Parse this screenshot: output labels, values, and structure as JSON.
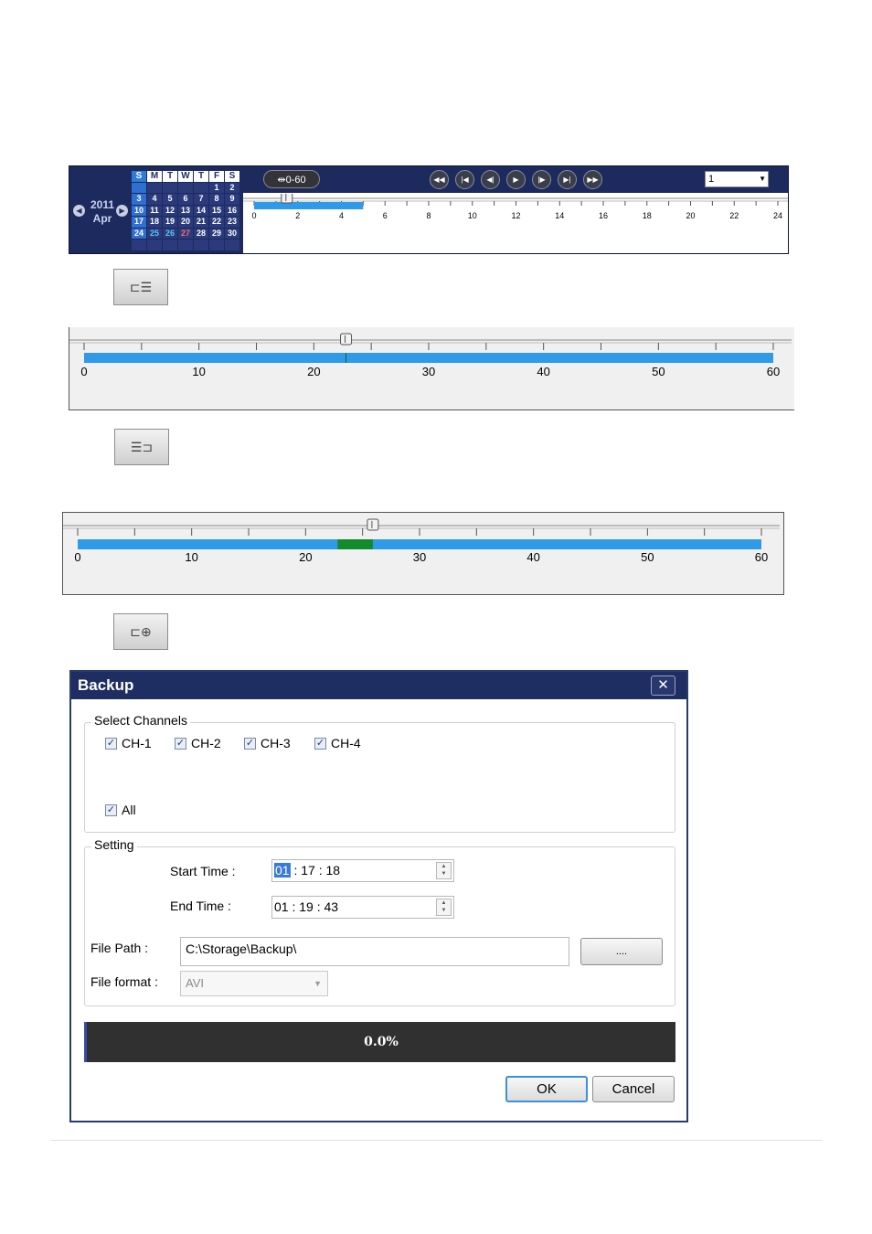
{
  "calendar": {
    "year": "2011",
    "month": "Apr",
    "weekday_headers": [
      "S",
      "M",
      "T",
      "W",
      "T",
      "F",
      "S"
    ],
    "weeks": [
      [
        "",
        "",
        "",
        "",
        "",
        "1",
        "2"
      ],
      [
        "3",
        "4",
        "5",
        "6",
        "7",
        "8",
        "9"
      ],
      [
        "10",
        "11",
        "12",
        "13",
        "14",
        "15",
        "16"
      ],
      [
        "17",
        "18",
        "19",
        "20",
        "21",
        "22",
        "23"
      ],
      [
        "24",
        "25",
        "26",
        "27",
        "28",
        "29",
        "30"
      ],
      [
        "",
        "",
        "",
        "",
        "",
        "",
        ""
      ]
    ]
  },
  "toolbar": {
    "range_label": "⇹0-60",
    "channel_value": "1",
    "playback_buttons": [
      {
        "name": "fast-rewind-button",
        "glyph": "◀◀"
      },
      {
        "name": "previous-frame-button",
        "glyph": "|◀"
      },
      {
        "name": "step-back-button",
        "glyph": "◀|"
      },
      {
        "name": "play-button",
        "glyph": "▶"
      },
      {
        "name": "step-forward-button",
        "glyph": "|▶"
      },
      {
        "name": "next-frame-button",
        "glyph": "▶|"
      },
      {
        "name": "fast-forward-button",
        "glyph": "▶▶"
      }
    ]
  },
  "day_timeline": {
    "ticks": [
      "0",
      "2",
      "4",
      "6",
      "8",
      "10",
      "12",
      "14",
      "16",
      "18",
      "20",
      "22",
      "24"
    ],
    "max": 24,
    "recorded": [
      0,
      5
    ],
    "cursor": 1.5
  },
  "buttons": {
    "mark_start_glyph": "⊏☰",
    "mark_end_glyph": "☰⊐",
    "backup_glyph": "⊏⊕"
  },
  "minute_timeline_1": {
    "ticks": [
      "0",
      "10",
      "20",
      "30",
      "40",
      "50",
      "60"
    ],
    "max": 60,
    "recorded": [
      0,
      60
    ],
    "marker": 22.8,
    "cursor": 22.8
  },
  "minute_timeline_2": {
    "ticks": [
      "0",
      "10",
      "20",
      "30",
      "40",
      "50",
      "60"
    ],
    "max": 60,
    "recorded": [
      0,
      60
    ],
    "selection": [
      22.8,
      25.9
    ],
    "cursor": 25.9
  },
  "backup_dialog": {
    "title": "Backup",
    "close_glyph": "✕",
    "channels_legend": "Select Channels",
    "channels": [
      "CH-1",
      "CH-2",
      "CH-3",
      "CH-4"
    ],
    "all_label": "All",
    "check_glyph": "✓",
    "setting_legend": "Setting",
    "start_time_label": "Start Time :",
    "start_time_hour": "01",
    "start_time_rest": " : 17 : 18",
    "end_time_label": "End Time :",
    "end_time_value": "01 : 19 : 43",
    "file_path_label": "File Path :",
    "file_path_value": "C:\\Storage\\Backup\\",
    "browse_label": "....",
    "file_format_label": "File format :",
    "file_format_value": "AVI",
    "progress_text": "0.0%",
    "progress": 0.0,
    "ok_label": "OK",
    "cancel_label": "Cancel"
  },
  "colors": {
    "panel_bg": "#1d2a5e",
    "recorded_bar": "#2f9be8",
    "selection_bar": "#138a2c",
    "progress_bg": "#303030"
  }
}
